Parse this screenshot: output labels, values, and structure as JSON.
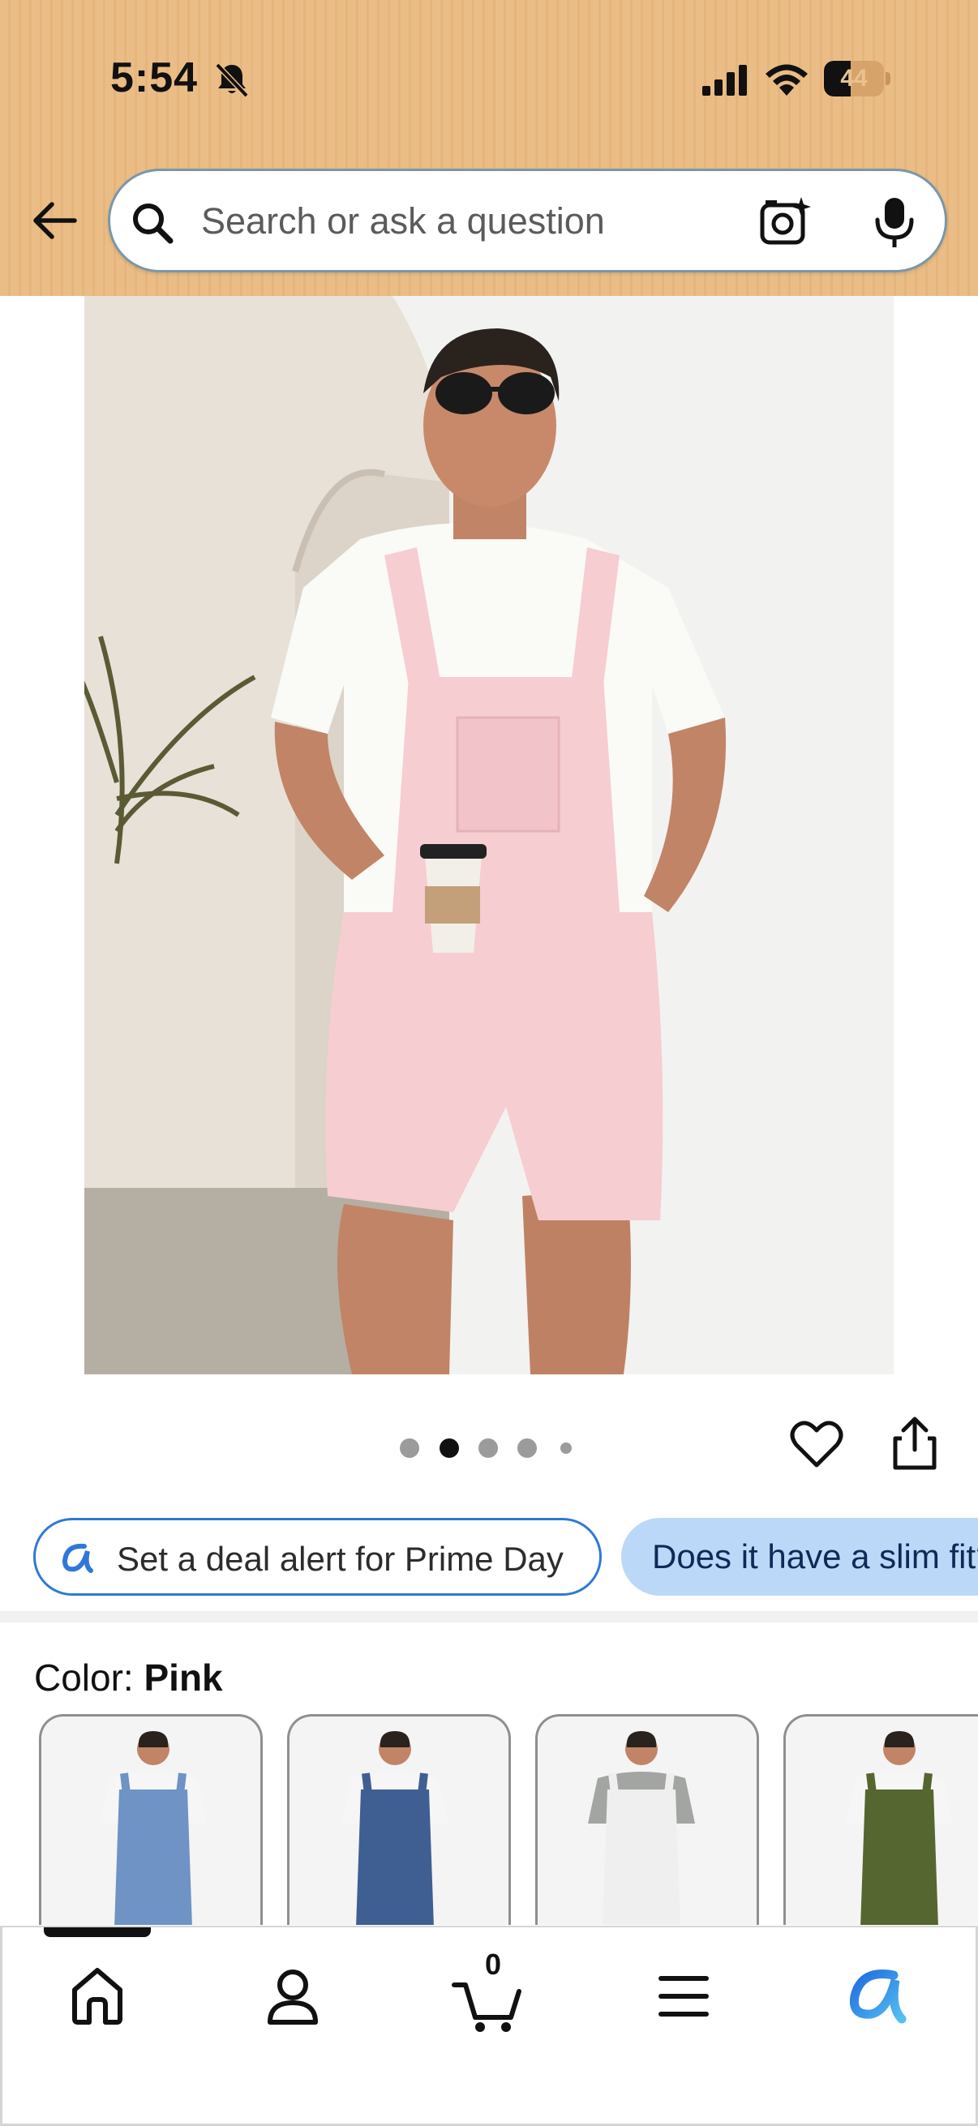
{
  "status_bar": {
    "time": "5:54",
    "battery_level": "44",
    "icons": [
      "bell-muted-icon",
      "cellular-signal-icon",
      "wifi-icon",
      "battery-icon"
    ]
  },
  "header": {
    "back_icon": "arrow-left-icon",
    "search": {
      "placeholder": "Search or ask a question",
      "icons": [
        "search-icon",
        "camera-sparkle-icon",
        "microphone-icon"
      ]
    },
    "background_color": "#ebbd86"
  },
  "product_image": {
    "carousel_total": 5,
    "carousel_active_index": 1,
    "actions": [
      "heart-icon",
      "share-icon"
    ]
  },
  "chips": {
    "deal_alert": "Set a deal alert for Prime Day",
    "question": "Does it have a slim fit?"
  },
  "color_selector": {
    "label": "Color: ",
    "selected": "Pink",
    "swatches": [
      {
        "name": "light-blue-denim",
        "color": "#6e93c4"
      },
      {
        "name": "dark-blue-denim",
        "color": "#3f5f92"
      },
      {
        "name": "white",
        "color": "#ececec"
      },
      {
        "name": "olive-green",
        "color": "#566630"
      }
    ]
  },
  "bottom_nav": {
    "items": [
      "home-icon",
      "profile-icon",
      "cart-icon",
      "menu-icon",
      "rufus-icon"
    ],
    "cart_count": "0",
    "active": "home"
  },
  "colors": {
    "accent_blue": "#2f78d8",
    "chip_fill": "#bcd8f8",
    "pink_overalls": "#f7cfd3"
  }
}
